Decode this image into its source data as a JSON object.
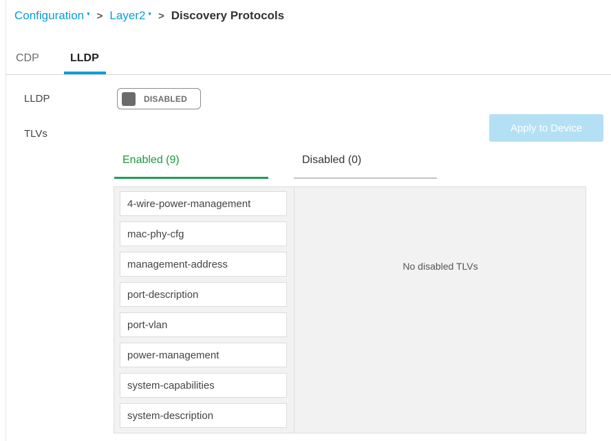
{
  "breadcrumb": {
    "items": [
      "Configuration",
      "Layer2"
    ],
    "current": "Discovery Protocols",
    "separator": ">",
    "caret": "▾"
  },
  "tabs": [
    {
      "label": "CDP",
      "active": false
    },
    {
      "label": "LLDP",
      "active": true
    }
  ],
  "lldp": {
    "label": "LLDP",
    "toggle_state": "DISABLED"
  },
  "tlvs": {
    "label": "TLVs",
    "apply_button": "Apply to Device",
    "enabled_tab": "Enabled (9)",
    "disabled_tab": "Disabled (0)",
    "enabled_items": [
      "4-wire-power-management",
      "mac-phy-cfg",
      "management-address",
      "port-description",
      "port-vlan",
      "power-management",
      "system-capabilities",
      "system-description"
    ],
    "disabled_empty_text": "No disabled TLVs"
  },
  "colors": {
    "accent": "#049fd9",
    "enabled_green": "#20a050",
    "apply_button_bg": "#b3e0f4"
  }
}
